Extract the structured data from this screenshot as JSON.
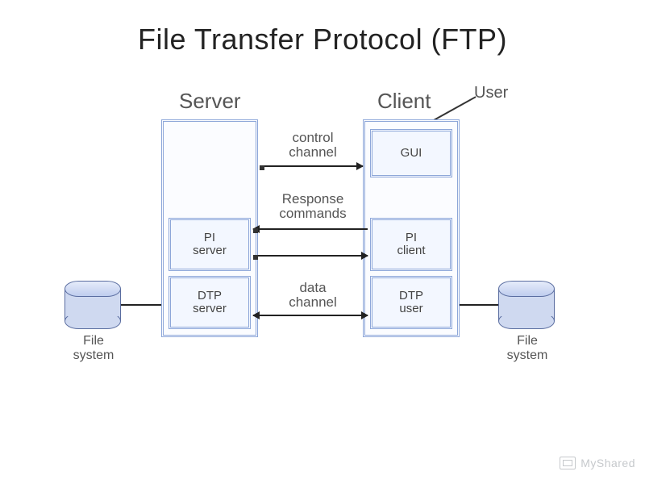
{
  "title": "File Transfer Protocol (FTP)",
  "labels": {
    "server": "Server",
    "client": "Client",
    "user": "User",
    "file_system_left": "File\nsystem",
    "file_system_right": "File\nsystem"
  },
  "server_boxes": {
    "pi": "PI\nserver",
    "dtp": "DTP\nserver"
  },
  "client_boxes": {
    "gui": "GUI",
    "pi": "PI\nclient",
    "dtp": "DTP\nuser"
  },
  "connections": {
    "control_channel": "control\nchannel",
    "response_commands": "Response\ncommands",
    "data_channel": "data\nchannel"
  },
  "watermark": "MyShared"
}
